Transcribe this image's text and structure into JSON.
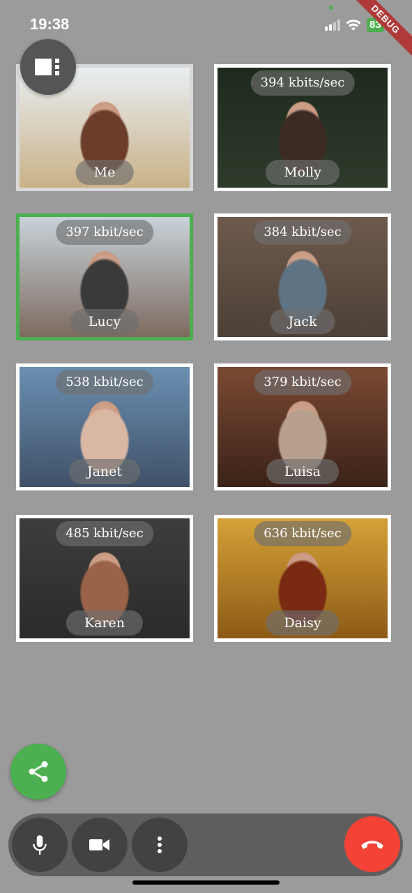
{
  "status_bar": {
    "time": "19:38",
    "battery": "83",
    "debug_label": "DEBUG"
  },
  "participants": [
    {
      "name": "Me",
      "bitrate": "",
      "state": "dim",
      "colors": [
        "#e9eef2",
        "#c9b187",
        "#6b3d2a"
      ]
    },
    {
      "name": "Molly",
      "bitrate": "394 kbits/sec",
      "state": "normal",
      "colors": [
        "#1e2a1d",
        "#2e3b2b",
        "#3c2b24"
      ]
    },
    {
      "name": "Lucy",
      "bitrate": "397 kbit/sec",
      "state": "active",
      "colors": [
        "#c8d3da",
        "#7d6a5f",
        "#3a3a3a"
      ]
    },
    {
      "name": "Jack",
      "bitrate": "384 kbit/sec",
      "state": "normal",
      "colors": [
        "#6e5a4c",
        "#4c4037",
        "#5e7383"
      ]
    },
    {
      "name": "Janet",
      "bitrate": "538 kbit/sec",
      "state": "normal",
      "colors": [
        "#6a8fb2",
        "#3f5168",
        "#d9b7a3"
      ]
    },
    {
      "name": "Luisa",
      "bitrate": "379 kbit/sec",
      "state": "normal",
      "colors": [
        "#7a4a33",
        "#3b2218",
        "#b7a08e"
      ]
    },
    {
      "name": "Karen",
      "bitrate": "485 kbit/sec",
      "state": "normal",
      "colors": [
        "#3d3d3d",
        "#2b2b2b",
        "#9a6248"
      ]
    },
    {
      "name": "Daisy",
      "bitrate": "636 kbit/sec",
      "state": "normal",
      "colors": [
        "#d5a138",
        "#8c5a16",
        "#7a2a12"
      ]
    }
  ],
  "controls": {
    "icons": [
      "layout-icon",
      "share-icon",
      "microphone-icon",
      "camera-icon",
      "more-options-icon",
      "hang-up-icon"
    ]
  },
  "accent_colors": {
    "active": "#4caf50",
    "hangup": "#f44336"
  }
}
